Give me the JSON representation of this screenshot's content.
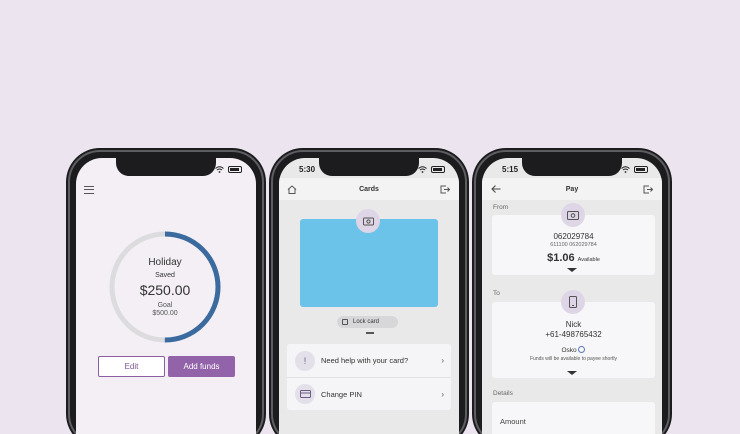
{
  "phone1": {
    "goal": {
      "title": "Holiday",
      "saved_label": "Saved",
      "saved_amount": "$250.00",
      "goal_label": "Goal",
      "goal_amount": "$500.00",
      "progress": 0.5
    },
    "buttons": {
      "edit": "Edit",
      "add_funds": "Add funds"
    },
    "colors": {
      "progress": "#3a6a9e",
      "track": "#dcdcdf",
      "accent": "#9263a8"
    }
  },
  "phone2": {
    "status_time": "5:30",
    "header_title": "Cards",
    "lock_card": "Lock card",
    "list": [
      {
        "label": "Need help with your card?",
        "icon": "help-icon"
      },
      {
        "label": "Change PIN",
        "icon": "card-icon"
      }
    ]
  },
  "phone3": {
    "status_time": "5:15",
    "header_title": "Pay",
    "from": {
      "section_label": "From",
      "account_number": "062029784",
      "bsb_line": "611100 062029784",
      "balance": "$1.06",
      "balance_suffix": "Available"
    },
    "to": {
      "section_label": "To",
      "name": "Nick",
      "phone": "+61-498765432",
      "network": "Osko",
      "note": "Funds will be available to payee shortly"
    },
    "details": {
      "section_label": "Details",
      "amount_label": "Amount"
    }
  }
}
